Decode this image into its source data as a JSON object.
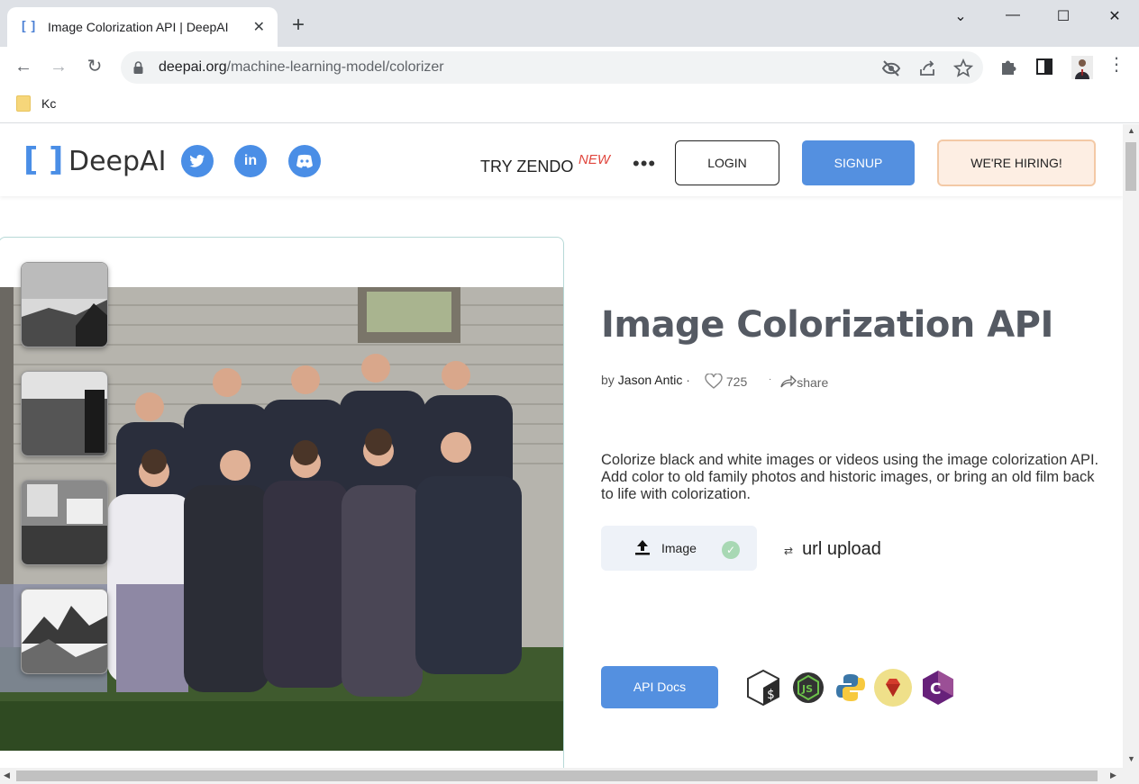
{
  "browser": {
    "tab_title": "Image Colorization API | DeepAI",
    "tab_favicon": "[ ]",
    "new_tab": "+",
    "url_domain": "deepai.org",
    "url_path": "/machine-learning-model/colorizer",
    "bookmarks": [
      {
        "label": "Kc",
        "icon": "folder-icon"
      }
    ],
    "window_controls": [
      "chevron-down-icon",
      "minimize-icon",
      "maximize-icon",
      "close-icon"
    ]
  },
  "site": {
    "logo_bracket_left": "[",
    "logo_bracket_right": "]",
    "logo_name": "DeepAI",
    "social": [
      {
        "name": "twitter",
        "glyph": "🐦"
      },
      {
        "name": "linkedin",
        "glyph": "in"
      },
      {
        "name": "discord",
        "glyph": "☺"
      }
    ],
    "nav": {
      "try_zendo": "TRY ZENDO",
      "new_badge": "NEW",
      "more": "•••",
      "login": "LOGIN",
      "signup": "SIGNUP",
      "hiring": "WE'RE HIRING!"
    },
    "accent_color": "#5490e0",
    "new_color": "#e0463d"
  },
  "main": {
    "title": "Image Colorization API",
    "by": "by",
    "author": "Jason Antic",
    "separator": "·",
    "likes": "725",
    "share": "share",
    "description": "Colorize black and white images or videos using the image colorization API. Add color to old family photos and historic images, or bring an old film back to life with colorization.",
    "upload_image_label": "Image",
    "url_upload_label": "url upload",
    "swap_glyph": "⇄",
    "api_docs": "API Docs",
    "languages": [
      "shell",
      "nodejs",
      "python",
      "ruby",
      "csharp"
    ]
  }
}
